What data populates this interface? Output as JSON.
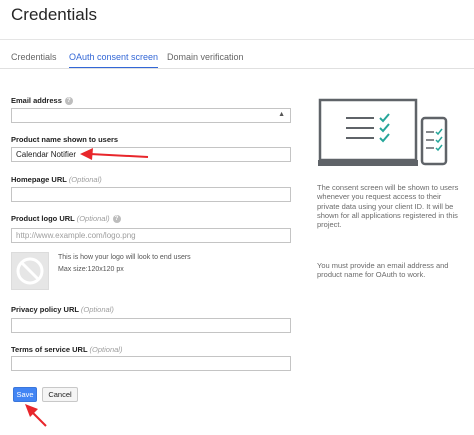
{
  "header": {
    "title": "Credentials"
  },
  "tabs": [
    {
      "label": "Credentials",
      "active": false
    },
    {
      "label": "OAuth consent screen",
      "active": true
    },
    {
      "label": "Domain verification",
      "active": false
    }
  ],
  "form": {
    "email": {
      "label": "Email address",
      "value": ""
    },
    "product_name": {
      "label": "Product name shown to users",
      "value": "Calendar Notifier"
    },
    "homepage": {
      "label": "Homepage URL",
      "optional": "(Optional)",
      "value": ""
    },
    "logo": {
      "label": "Product logo URL",
      "optional": "(Optional)",
      "placeholder": "http://www.example.com/logo.png",
      "hint": "This is how your logo will look to end users",
      "max_size": "Max size:120x120 px"
    },
    "privacy": {
      "label": "Privacy policy URL",
      "optional": "(Optional)",
      "value": ""
    },
    "tos": {
      "label": "Terms of service URL",
      "optional": "(Optional)",
      "value": ""
    }
  },
  "buttons": {
    "save": "Save",
    "cancel": "Cancel"
  },
  "info": {
    "paragraph1": "The consent screen will be shown to users whenever you request access to their private data using your client ID. It will be shown for all applications registered in this project.",
    "paragraph2": "You must provide an email address and product name for OAuth to work."
  },
  "colors": {
    "accent": "#4285f4",
    "tab_active": "#3367d6",
    "annotation_arrow": "#e8262b",
    "check": "#26a69a"
  }
}
